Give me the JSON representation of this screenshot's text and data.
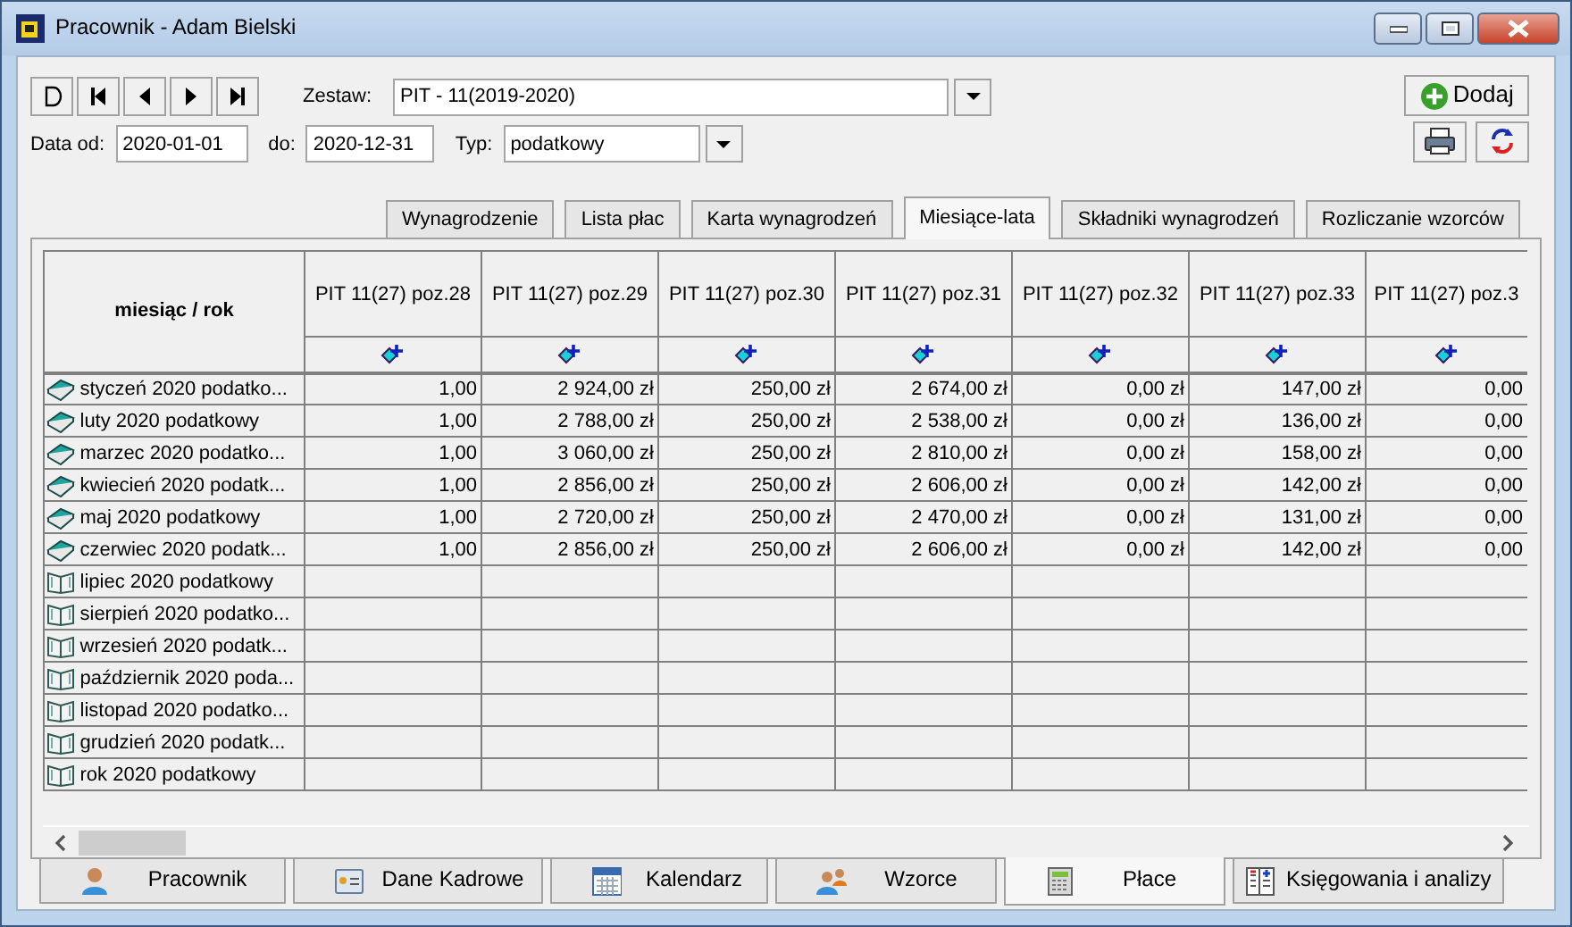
{
  "window": {
    "title": "Pracownik - Adam Bielski"
  },
  "filter": {
    "set_label": "Zestaw:",
    "set_value": "PIT - 11(2019-2020)",
    "date_from_label": "Data od:",
    "date_from": "2020-01-01",
    "date_to_label": "do:",
    "date_to": "2020-12-31",
    "type_label": "Typ:",
    "type_value": "podatkowy"
  },
  "add_button": "Dodaj",
  "tabs": [
    {
      "label": "Wynagrodzenie",
      "selected": false
    },
    {
      "label": "Lista płac",
      "selected": false
    },
    {
      "label": "Karta wynagrodzeń",
      "selected": false
    },
    {
      "label": "Miesiące-lata",
      "selected": true
    },
    {
      "label": "Składniki wynagrodzeń",
      "selected": false
    },
    {
      "label": "Rozliczanie wzorców",
      "selected": false
    }
  ],
  "table": {
    "first_column": "miesiąc / rok",
    "columns": [
      "PIT 11(27) poz.28",
      "PIT 11(27) poz.29",
      "PIT 11(27) poz.30",
      "PIT 11(27) poz.31",
      "PIT 11(27) poz.32",
      "PIT 11(27) poz.33",
      "PIT 11(27) poz.3"
    ],
    "rows": [
      {
        "kind": "closed",
        "label": "styczeń 2020 podatko...",
        "values": [
          "1,00",
          "2 924,00 zł",
          "250,00 zł",
          "2 674,00 zł",
          "0,00 zł",
          "147,00 zł",
          "0,00"
        ]
      },
      {
        "kind": "closed",
        "label": "luty 2020 podatkowy",
        "values": [
          "1,00",
          "2 788,00 zł",
          "250,00 zł",
          "2 538,00 zł",
          "0,00 zł",
          "136,00 zł",
          "0,00"
        ]
      },
      {
        "kind": "closed",
        "label": "marzec 2020 podatko...",
        "values": [
          "1,00",
          "3 060,00 zł",
          "250,00 zł",
          "2 810,00 zł",
          "0,00 zł",
          "158,00 zł",
          "0,00"
        ]
      },
      {
        "kind": "closed",
        "label": "kwiecień 2020 podatk...",
        "values": [
          "1,00",
          "2 856,00 zł",
          "250,00 zł",
          "2 606,00 zł",
          "0,00 zł",
          "142,00 zł",
          "0,00"
        ]
      },
      {
        "kind": "closed",
        "label": "maj 2020 podatkowy",
        "values": [
          "1,00",
          "2 720,00 zł",
          "250,00 zł",
          "2 470,00 zł",
          "0,00 zł",
          "131,00 zł",
          "0,00"
        ]
      },
      {
        "kind": "closed",
        "label": "czerwiec 2020 podatk...",
        "values": [
          "1,00",
          "2 856,00 zł",
          "250,00 zł",
          "2 606,00 zł",
          "0,00 zł",
          "142,00 zł",
          "0,00"
        ]
      },
      {
        "kind": "open",
        "label": "lipiec 2020 podatkowy"
      },
      {
        "kind": "open",
        "label": "sierpień 2020 podatko..."
      },
      {
        "kind": "open",
        "label": "wrzesień 2020 podatk..."
      },
      {
        "kind": "open",
        "label": "październik 2020 poda..."
      },
      {
        "kind": "open",
        "label": "listopad 2020 podatko..."
      },
      {
        "kind": "open",
        "label": "grudzień 2020 podatk..."
      },
      {
        "kind": "open",
        "label": "rok 2020 podatkowy"
      }
    ]
  },
  "bottom_tabs": [
    {
      "kind": "person",
      "label": "Pracownik",
      "selected": false
    },
    {
      "kind": "card",
      "label": "Dane Kadrowe",
      "selected": false
    },
    {
      "kind": "calendar",
      "label": "Kalendarz",
      "selected": false
    },
    {
      "kind": "people",
      "label": "Wzorce",
      "selected": false
    },
    {
      "kind": "calculator",
      "label": "Płace",
      "selected": true
    },
    {
      "kind": "ledger",
      "label": "Księgowania i analizy",
      "selected": false
    }
  ]
}
